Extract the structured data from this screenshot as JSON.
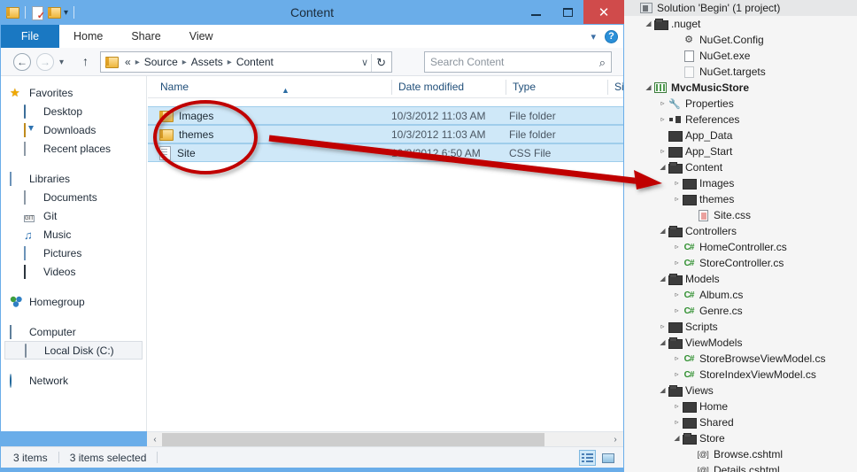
{
  "window": {
    "title": "Content",
    "toolbar_icons": [
      "folder-icon",
      "new-folder-icon",
      "folder-icon",
      "dropdown-caret-icon"
    ],
    "controls": {
      "minimize": "Minimize",
      "maximize": "Maximize",
      "close": "Close"
    }
  },
  "ribbon": {
    "tabs": [
      {
        "label": "File",
        "active": true
      },
      {
        "label": "Home",
        "active": false
      },
      {
        "label": "Share",
        "active": false
      },
      {
        "label": "View",
        "active": false
      }
    ],
    "collapse_icon": "chevron-down-icon",
    "help_icon": "help-icon",
    "help_label": "?"
  },
  "addressbar": {
    "back_label": "←",
    "forward_label": "→",
    "recent_label": "▾",
    "up_label": "↑",
    "folder_icon": "folder-icon",
    "prefix": "«",
    "crumbs": [
      "Source",
      "Assets",
      "Content"
    ],
    "separator": "▸",
    "dropdown_label": "∨",
    "refresh_label": "↻"
  },
  "search": {
    "placeholder": "Search Content",
    "value": "",
    "icon": "search-icon"
  },
  "navpane": {
    "groups": [
      {
        "root": {
          "label": "Favorites",
          "icon": "star-icon"
        },
        "children": [
          {
            "label": "Desktop",
            "icon": "desktop-icon"
          },
          {
            "label": "Downloads",
            "icon": "downloads-icon"
          },
          {
            "label": "Recent places",
            "icon": "recent-places-icon"
          }
        ]
      },
      {
        "root": {
          "label": "Libraries",
          "icon": "libraries-icon"
        },
        "children": [
          {
            "label": "Documents",
            "icon": "documents-icon"
          },
          {
            "label": "Git",
            "icon": "git-icon"
          },
          {
            "label": "Music",
            "icon": "music-icon"
          },
          {
            "label": "Pictures",
            "icon": "pictures-icon"
          },
          {
            "label": "Videos",
            "icon": "videos-icon"
          }
        ]
      },
      {
        "root": {
          "label": "Homegroup",
          "icon": "homegroup-icon"
        },
        "children": []
      },
      {
        "root": {
          "label": "Computer",
          "icon": "computer-icon"
        },
        "children": [
          {
            "label": "Local Disk (C:)",
            "icon": "disk-icon",
            "selected": true
          }
        ]
      },
      {
        "root": {
          "label": "Network",
          "icon": "network-icon"
        },
        "children": []
      }
    ]
  },
  "filelist": {
    "columns": [
      {
        "label": "Name",
        "sorted": "asc",
        "sort_glyph": "▲"
      },
      {
        "label": "Date modified"
      },
      {
        "label": "Type"
      },
      {
        "label": "Si"
      }
    ],
    "rows": [
      {
        "name": "Images",
        "icon": "folder-icon",
        "date": "10/3/2012 11:03 AM",
        "type": "File folder",
        "selected": true
      },
      {
        "name": "themes",
        "icon": "folder-icon",
        "date": "10/3/2012 11:03 AM",
        "type": "File folder",
        "selected": true
      },
      {
        "name": "Site",
        "icon": "css-file-icon",
        "date": "10/3/2012 6:50 AM",
        "type": "CSS File",
        "selected": true
      }
    ]
  },
  "hscroll": {
    "left_arrow": "‹",
    "right_arrow": "›"
  },
  "statusbar": {
    "item_count": "3 items",
    "selection_count": "3 items selected",
    "view_details": "details-view-button",
    "view_thumbnails": "thumbnail-view-button"
  },
  "solution_explorer": {
    "rows": [
      {
        "indent": 0,
        "twisty": "",
        "icon": "solution-icon",
        "label": "Solution 'Begin' (1 project)",
        "bold": false,
        "header": true
      },
      {
        "indent": 1,
        "twisty": "◢",
        "icon": "folder-open-icon",
        "label": ".nuget",
        "bold": false
      },
      {
        "indent": 3,
        "twisty": "",
        "icon": "config-file-icon",
        "label": "NuGet.Config",
        "bold": false
      },
      {
        "indent": 3,
        "twisty": "",
        "icon": "file-icon",
        "label": "NuGet.exe",
        "bold": false
      },
      {
        "indent": 3,
        "twisty": "",
        "icon": "file-plain-icon",
        "label": "NuGet.targets",
        "bold": false
      },
      {
        "indent": 1,
        "twisty": "◢",
        "icon": "project-icon",
        "label": "MvcMusicStore",
        "bold": true
      },
      {
        "indent": 2,
        "twisty": "▹",
        "icon": "wrench-icon",
        "label": "Properties",
        "bold": false
      },
      {
        "indent": 2,
        "twisty": "▹",
        "icon": "references-icon",
        "label": "References",
        "bold": false
      },
      {
        "indent": 2,
        "twisty": "",
        "icon": "folder-closed-icon",
        "label": "App_Data",
        "bold": false
      },
      {
        "indent": 2,
        "twisty": "▹",
        "icon": "folder-closed-icon",
        "label": "App_Start",
        "bold": false
      },
      {
        "indent": 2,
        "twisty": "◢",
        "icon": "folder-open-icon",
        "label": "Content",
        "bold": false
      },
      {
        "indent": 3,
        "twisty": "▹",
        "icon": "folder-closed-icon",
        "label": "Images",
        "bold": false
      },
      {
        "indent": 3,
        "twisty": "▹",
        "icon": "folder-closed-icon",
        "label": "themes",
        "bold": false
      },
      {
        "indent": 4,
        "twisty": "",
        "icon": "css-file-icon",
        "label": "Site.css",
        "bold": false
      },
      {
        "indent": 2,
        "twisty": "◢",
        "icon": "folder-open-icon",
        "label": "Controllers",
        "bold": false
      },
      {
        "indent": 3,
        "twisty": "▹",
        "icon": "csharp-icon",
        "label": "HomeController.cs",
        "bold": false
      },
      {
        "indent": 3,
        "twisty": "▹",
        "icon": "csharp-icon",
        "label": "StoreController.cs",
        "bold": false
      },
      {
        "indent": 2,
        "twisty": "◢",
        "icon": "folder-open-icon",
        "label": "Models",
        "bold": false
      },
      {
        "indent": 3,
        "twisty": "▹",
        "icon": "csharp-icon",
        "label": "Album.cs",
        "bold": false
      },
      {
        "indent": 3,
        "twisty": "▹",
        "icon": "csharp-icon",
        "label": "Genre.cs",
        "bold": false
      },
      {
        "indent": 2,
        "twisty": "▹",
        "icon": "folder-closed-icon",
        "label": "Scripts",
        "bold": false
      },
      {
        "indent": 2,
        "twisty": "◢",
        "icon": "folder-open-icon",
        "label": "ViewModels",
        "bold": false
      },
      {
        "indent": 3,
        "twisty": "▹",
        "icon": "csharp-icon",
        "label": "StoreBrowseViewModel.cs",
        "bold": false
      },
      {
        "indent": 3,
        "twisty": "▹",
        "icon": "csharp-icon",
        "label": "StoreIndexViewModel.cs",
        "bold": false
      },
      {
        "indent": 2,
        "twisty": "◢",
        "icon": "folder-open-icon",
        "label": "Views",
        "bold": false
      },
      {
        "indent": 3,
        "twisty": "▹",
        "icon": "folder-closed-icon",
        "label": "Home",
        "bold": false
      },
      {
        "indent": 3,
        "twisty": "▹",
        "icon": "folder-closed-icon",
        "label": "Shared",
        "bold": false
      },
      {
        "indent": 3,
        "twisty": "◢",
        "icon": "folder-open-icon",
        "label": "Store",
        "bold": false
      },
      {
        "indent": 4,
        "twisty": "",
        "icon": "cshtml-icon",
        "label": "Browse.cshtml",
        "bold": false
      },
      {
        "indent": 4,
        "twisty": "",
        "icon": "cshtml-icon",
        "label": "Details.cshtml",
        "bold": false
      }
    ]
  },
  "annotations": {
    "ellipse_color": "#c00000",
    "arrow_color": "#c00000",
    "ellipse_name": "selected-items-highlight",
    "arrow_name": "drag-target-arrow"
  }
}
